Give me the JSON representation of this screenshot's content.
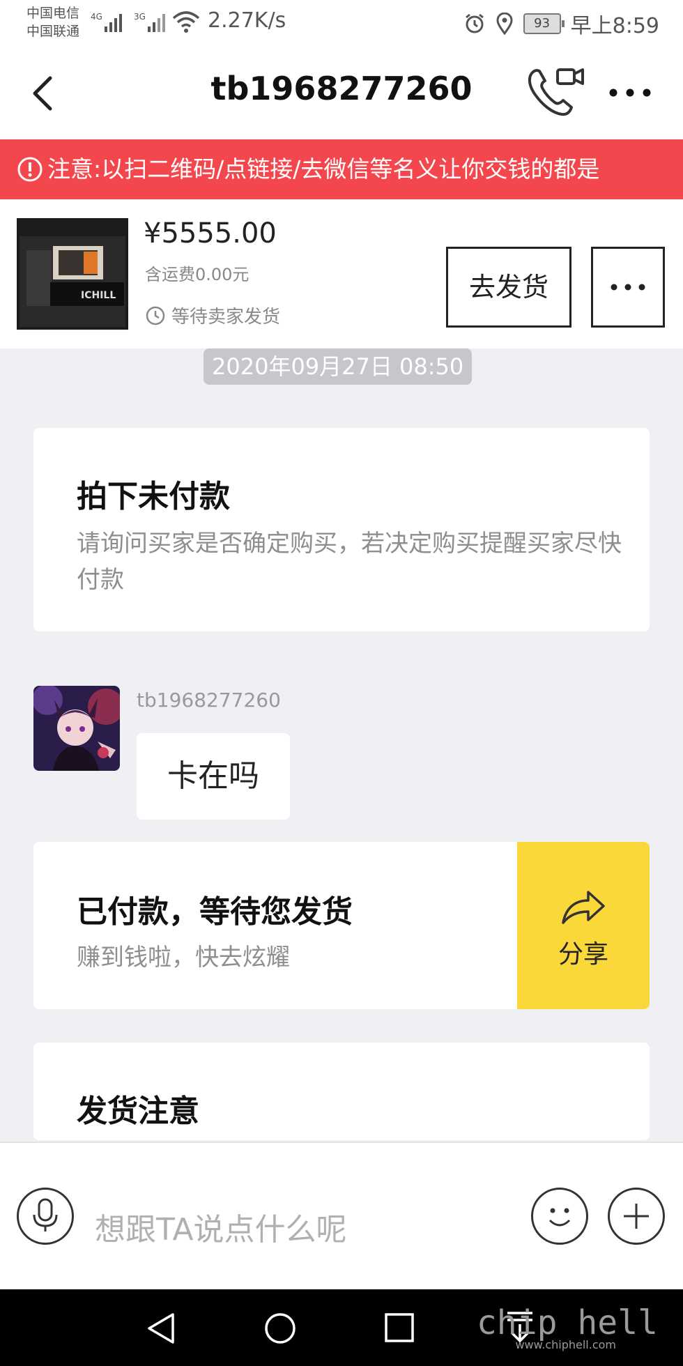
{
  "status_bar": {
    "carrier_1": "中国电信",
    "carrier_2": "中国联通",
    "net_1": "4G",
    "net_2": "3G",
    "speed": "2.27K/s",
    "battery": "93",
    "time": "早上8:59"
  },
  "nav": {
    "title": "tb1968277260"
  },
  "warning": {
    "text": "注意:以扫二维码/点链接/去微信等名义让你交钱的都是"
  },
  "order": {
    "price": "¥5555.00",
    "shipping": "含运费0.00元",
    "status": "等待卖家发货",
    "product_brand": "ICHILL",
    "ship_button": "去发货"
  },
  "chat": {
    "timestamp": "2020年09月27日 08:50",
    "card1": {
      "title": "拍下未付款",
      "desc": "请询问买家是否确定购买，若决定购买提醒买家尽快付款"
    },
    "message": {
      "sender": "tb1968277260",
      "text": "卡在吗"
    },
    "card2": {
      "title": "已付款，等待您发货",
      "desc": "赚到钱啦，快去炫耀",
      "share_label": "分享"
    },
    "card3": {
      "title": "发货注意"
    }
  },
  "input": {
    "placeholder": "想跟TA说点什么呢"
  },
  "watermark": {
    "text": "chip hell",
    "url": "www.chiphell.com"
  }
}
